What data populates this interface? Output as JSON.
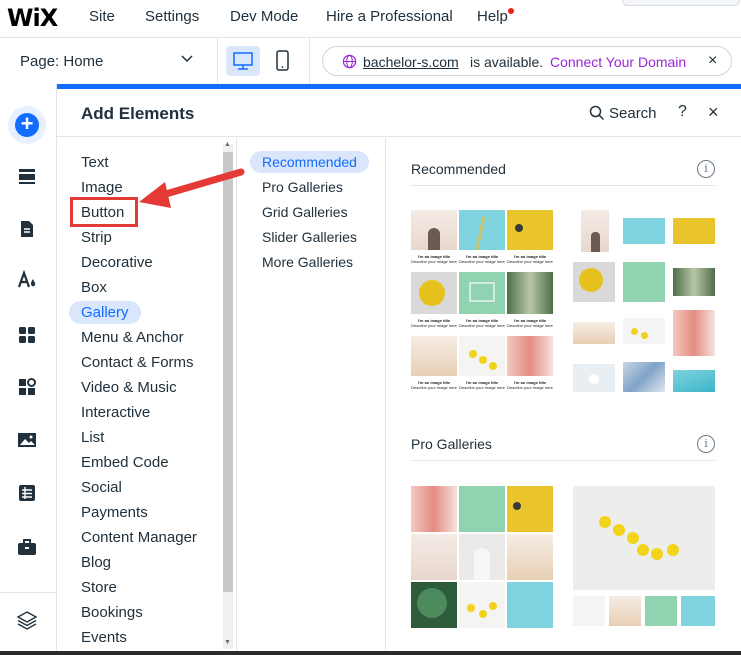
{
  "topbar": {
    "logo": "WiX",
    "menu": [
      "Site",
      "Settings",
      "Dev Mode",
      "Hire a Professional",
      "Help"
    ]
  },
  "secondary_bar": {
    "page_label": "Page: Home",
    "domain": {
      "name": "bachelor-s.com",
      "status": "is available.",
      "action": "Connect Your Domain"
    }
  },
  "panel": {
    "title": "Add Elements",
    "search_label": "Search",
    "help_label": "?",
    "close_label": "×",
    "categories": [
      "Text",
      "Image",
      "Button",
      "Strip",
      "Decorative",
      "Box",
      "Gallery",
      "Menu & Anchor",
      "Contact & Forms",
      "Video & Music",
      "Interactive",
      "List",
      "Embed Code",
      "Social",
      "Payments",
      "Content Manager",
      "Blog",
      "Store",
      "Bookings",
      "Events"
    ],
    "selected_category": "Gallery",
    "subcategories": [
      "Recommended",
      "Pro Galleries",
      "Grid Galleries",
      "Slider Galleries",
      "More Galleries"
    ],
    "selected_subcategory": "Recommended",
    "sections": [
      {
        "title": "Recommended"
      },
      {
        "title": "Pro Galleries"
      }
    ],
    "caption_title": "I'm an image title",
    "caption_desc": "Describe your image here"
  },
  "colors": {
    "accent": "#116dff",
    "selection_bg": "#d9e6fb",
    "connect_link": "#9a27d5",
    "annotation_red": "#e53935"
  },
  "icons": {
    "rail": [
      "add-icon",
      "sections-icon",
      "pages-icon",
      "design-icon",
      "apps-icon",
      "business-icon",
      "media-icon",
      "cms-icon",
      "portfolio-icon",
      "layers-icon"
    ]
  }
}
